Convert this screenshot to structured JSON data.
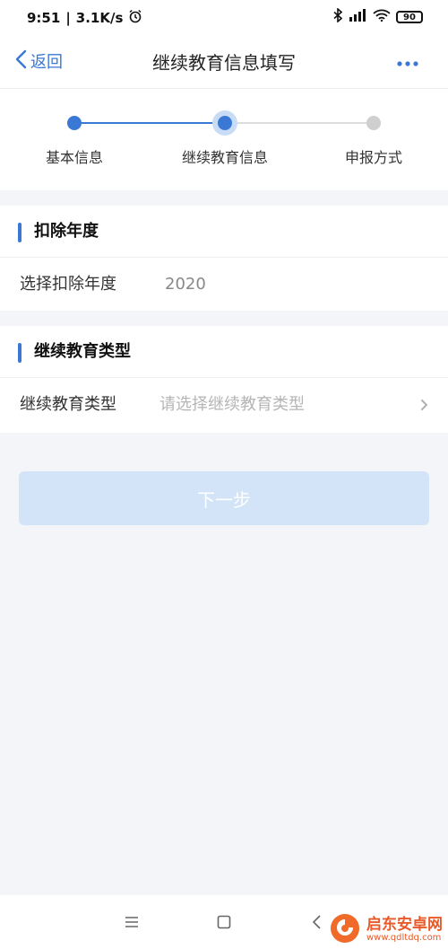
{
  "status_bar": {
    "time": "9:51",
    "network_speed": "3.1K/s",
    "battery": "90",
    "icons": [
      "alarm-icon",
      "bluetooth-icon",
      "signal-icon",
      "wifi-icon",
      "battery-icon"
    ]
  },
  "nav": {
    "back_label": "返回",
    "title": "继续教育信息填写",
    "more_icon": "more-dots-icon"
  },
  "stepper": {
    "steps": [
      {
        "label": "基本信息",
        "state": "done"
      },
      {
        "label": "继续教育信息",
        "state": "active"
      },
      {
        "label": "申报方式",
        "state": "pending"
      }
    ],
    "colors": {
      "active": "#3a78d6",
      "pending": "#cfcfcf"
    }
  },
  "section_year": {
    "title": "扣除年度",
    "field_label": "选择扣除年度",
    "field_value": "2020"
  },
  "section_type": {
    "title": "继续教育类型",
    "field_label": "继续教育类型",
    "field_placeholder": "请选择继续教育类型"
  },
  "next_button": {
    "label": "下一步",
    "enabled": false
  },
  "system_nav": {
    "icons": [
      "menu-icon",
      "home-icon",
      "back-icon"
    ]
  },
  "watermark": {
    "main": "启东安卓网",
    "sub": "www.qdltdq.com"
  },
  "colors": {
    "accent": "#3a78d6",
    "page_bg": "#f3f5f9",
    "button_disabled": "#d3e4f8",
    "watermark": "#e85a2a"
  }
}
